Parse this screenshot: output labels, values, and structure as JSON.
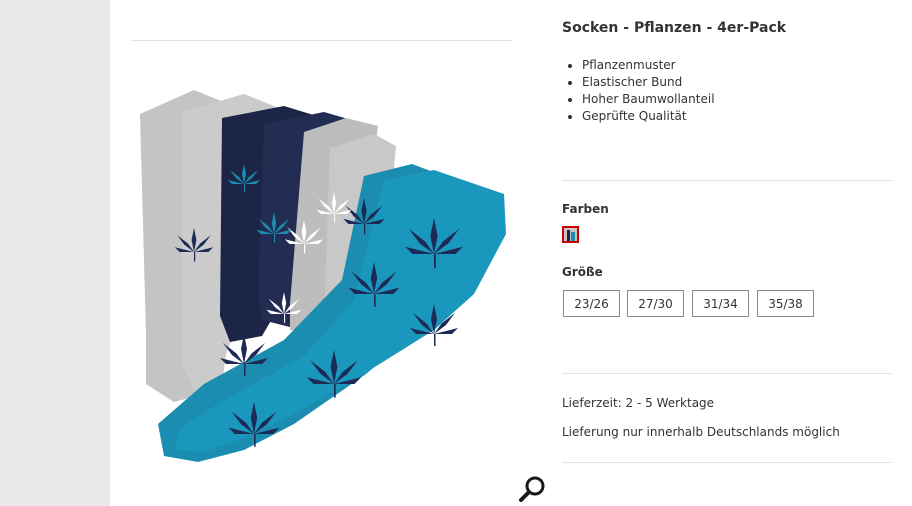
{
  "product": {
    "title": "Socken - Pflanzen - 4er-Pack",
    "features": [
      "Pflanzenmuster",
      "Elastischer Bund",
      "Hoher Baumwollanteil",
      "Geprüfte Qualität"
    ]
  },
  "colors": {
    "label": "Farben",
    "swatch_selected_border": "#cc0000"
  },
  "sizes": {
    "label": "Größe",
    "options": [
      "23/26",
      "27/30",
      "31/34",
      "35/38"
    ]
  },
  "delivery": {
    "time": "Lieferzeit: 2 - 5 Werktage",
    "note": "Lieferung nur innerhalb Deutschlands möglich"
  },
  "icons": {
    "zoom": "magnifier-icon",
    "image_subject": "socks-4-pack-plant-pattern"
  },
  "palette": {
    "gutter": "#e9e9e9",
    "sock_grey": "#c4c4c4",
    "sock_navy": "#1d2547",
    "sock_teal": "#1b8db0",
    "leaf_navy": "#1c2a55"
  }
}
